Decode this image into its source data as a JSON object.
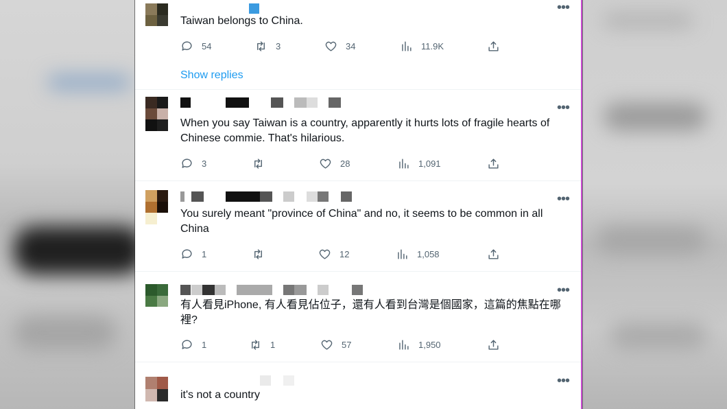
{
  "colors": {
    "link": "#1d9bf0",
    "text": "#0f1419",
    "muted": "#536471"
  },
  "show_replies_label": "Show replies",
  "more_label": "•••",
  "posts": [
    {
      "text": "Taiwan belongs to China.",
      "actions": {
        "reply": "54",
        "retweet": "3",
        "like": "34",
        "views": "11.9K"
      }
    },
    {
      "text": "When you say Taiwan is a country, apparently it hurts lots of fragile hearts of Chinese commie. That's hilarious.",
      "actions": {
        "reply": "3",
        "retweet": "",
        "like": "28",
        "views": "1,091"
      }
    },
    {
      "text": "You surely meant \"province of China\" and no, it seems to be common in all China",
      "actions": {
        "reply": "1",
        "retweet": "",
        "like": "12",
        "views": "1,058"
      }
    },
    {
      "text": "有人看見iPhone, 有人看見佔位子，還有人看到台灣是個國家，這篇的焦點在哪裡?",
      "actions": {
        "reply": "1",
        "retweet": "1",
        "like": "57",
        "views": "1,950"
      }
    },
    {
      "text": "it's not a country"
    }
  ],
  "icons": [
    "reply-icon",
    "retweet-icon",
    "like-icon",
    "views-icon",
    "share-icon",
    "more-icon"
  ]
}
